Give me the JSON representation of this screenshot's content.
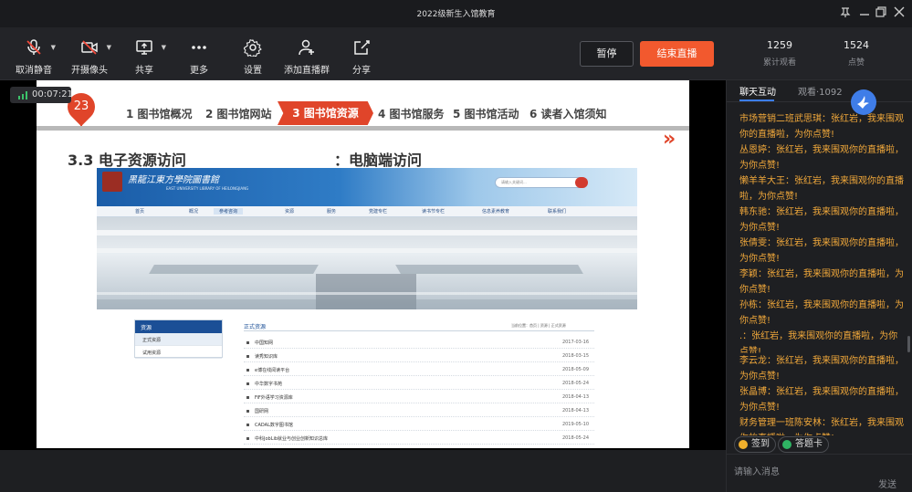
{
  "window": {
    "title": "2022级新生入馆教育",
    "controls": [
      "pin-icon",
      "minimize-icon",
      "restore-icon",
      "close-icon"
    ]
  },
  "toolbar": {
    "items": [
      {
        "label": "取消静音",
        "icon": "mic-muted-icon"
      },
      {
        "label": "开摄像头",
        "icon": "camera-off-icon"
      },
      {
        "label": "共享",
        "icon": "screen-share-icon"
      },
      {
        "label": "更多",
        "icon": "more-icon"
      },
      {
        "label": "设置",
        "icon": "gear-icon"
      },
      {
        "label": "添加直播群",
        "icon": "add-group-icon"
      },
      {
        "label": "分享",
        "icon": "share-icon"
      }
    ],
    "pause_label": "暂停",
    "end_label": "结束直播",
    "stats": [
      {
        "value": "1259",
        "caption": "累计观看"
      },
      {
        "value": "1524",
        "caption": "点赞"
      }
    ]
  },
  "stage": {
    "timer": "00:07:21",
    "slide": {
      "badge": "23",
      "steps": [
        "1 图书馆概况",
        "2 图书馆网站",
        "3 图书馆资源",
        "4 图书馆服务",
        "5 图书馆活动",
        "6 读者入馆须知"
      ],
      "active_step": 2,
      "heading_left": "3.3 电子资源访问",
      "heading_right": "：电脑端访问",
      "chevrons": "»",
      "website": {
        "logo_text": "黑龍江東方學院圖書館",
        "logo_sub": "EAST UNIVERSITY LIBRARY OF HEILONGJIANG",
        "search_placeholder": "请输入关键词...",
        "nav": [
          "首页",
          "概况",
          "参考咨询",
          "资源",
          "服务",
          "党建专栏",
          "读书节专栏",
          "信息素养教育",
          "联系我们"
        ],
        "nav_active": 2,
        "side_title": "资源",
        "side_items": [
          "正式资源",
          "试用资源"
        ],
        "list_title": "正式资源",
        "crumb": "当前位置：首页 | 资源 | 正式资源",
        "rows": [
          {
            "name": "中国知网",
            "date": "2017-03-16"
          },
          {
            "name": "读秀知识库",
            "date": "2018-03-15"
          },
          {
            "name": "e博在线阅读平台",
            "date": "2018-05-09"
          },
          {
            "name": "中华数字书苑",
            "date": "2018-05-24"
          },
          {
            "name": "FiF外语学习资源库",
            "date": "2018-04-13"
          },
          {
            "name": "国研网",
            "date": "2018-04-13"
          },
          {
            "name": "CADAL数字图书馆",
            "date": "2019-05-10"
          },
          {
            "name": "中科JobLib就业与创业创新知识总库",
            "date": "2018-05-24"
          }
        ]
      }
    }
  },
  "chat_panel": {
    "tab_chat": "聊天互动",
    "tab_viewers": "观看·1092",
    "messages": [
      "市场营销二班武思琪：张红岩，我来围观你的直播啦，为你点赞!",
      "丛恩婷：张红岩，我来围观你的直播啦，为你点赞!",
      "懒羊羊大王：张红岩，我来围观你的直播啦，为你点赞!",
      "韩东驰：张红岩，我来围观你的直播啦，为你点赞!",
      "张倩雯：张红岩，我来围观你的直播啦，为你点赞!",
      "李颖：张红岩，我来围观你的直播啦，为你点赞!",
      "孙栋：张红岩，我来围观你的直播啦，为你点赞!",
      ".：张红岩，我来围观你的直播啦，为你点赞!",
      "李云龙：张红岩，我来围观你的直播啦，为你点赞!",
      "张晶博：张红岩，我来围观你的直播啦，为你点赞!",
      "财务管理一班陈安林：张红岩，我来围观你的直播啦，为你点赞!"
    ],
    "signin_label": "签到",
    "answer_card_label": "答题卡",
    "input_placeholder": "请输入消息",
    "send_label": "发送"
  },
  "colors": {
    "accent_orange": "#f2592e",
    "slide_red": "#e0452a",
    "chat_text": "#f2a93b",
    "tab_blue": "#3b7df0"
  }
}
